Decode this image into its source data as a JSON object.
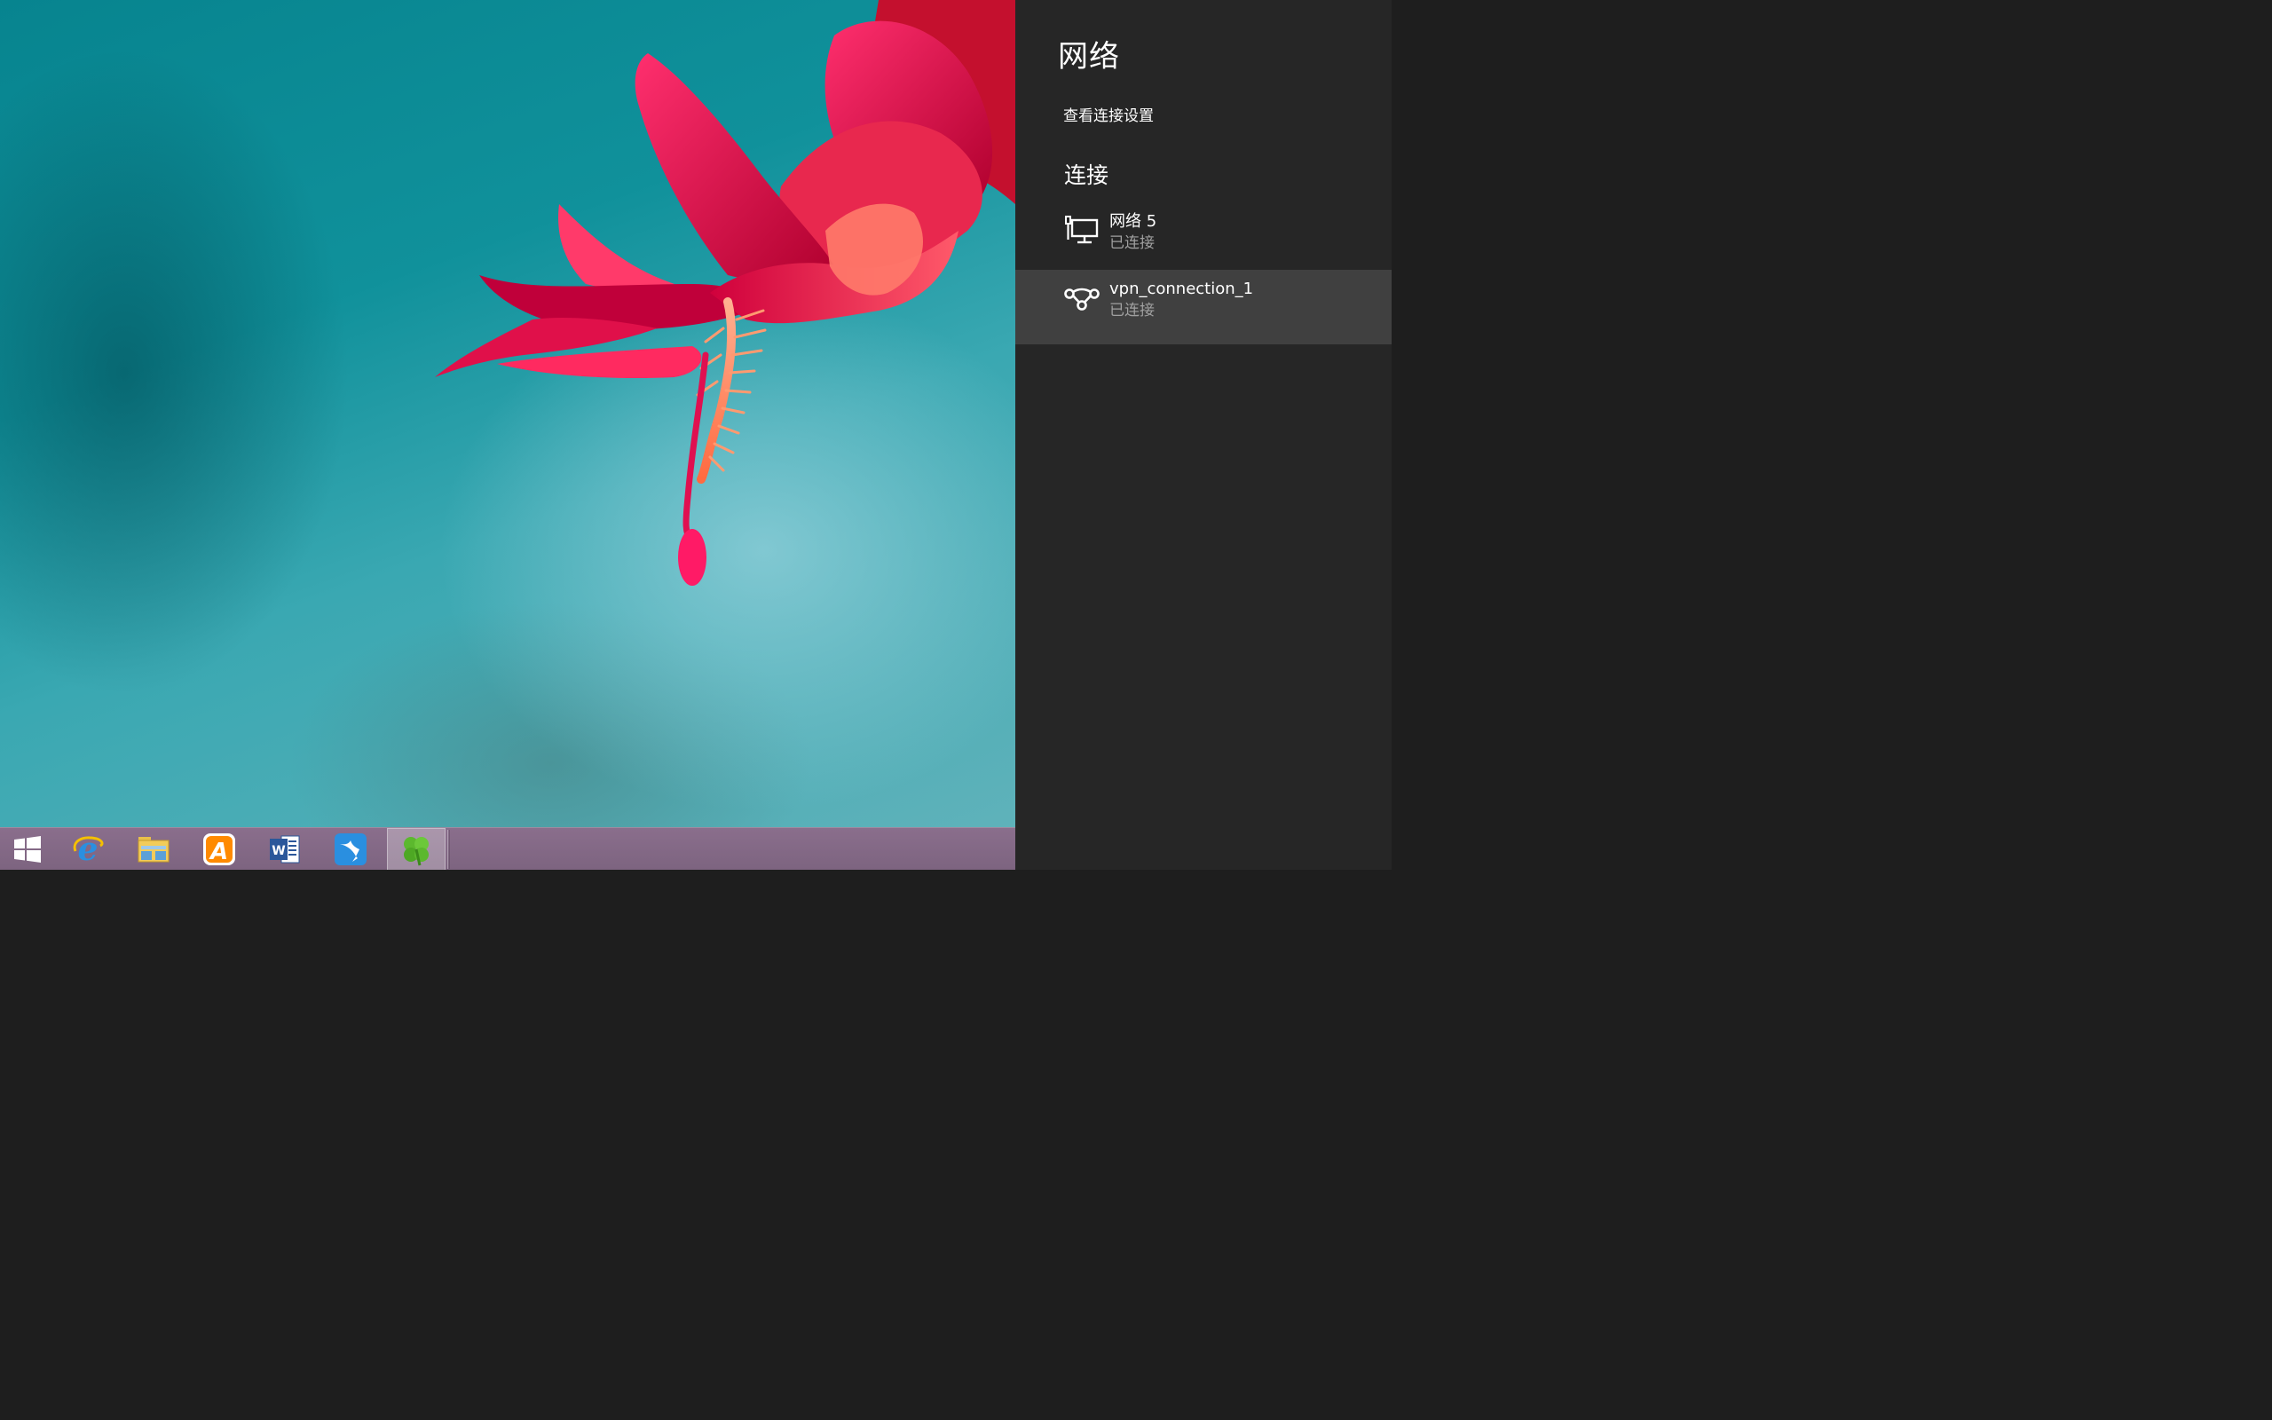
{
  "panel": {
    "title": "网络",
    "view_settings_label": "查看连接设置",
    "section_title": "连接",
    "connections": [
      {
        "name": "网络  5",
        "status": "已连接",
        "icon": "ethernet-icon",
        "selected": false
      },
      {
        "name": "vpn_connection_1",
        "status": "已连接",
        "icon": "vpn-icon",
        "selected": true
      }
    ]
  },
  "taskbar": {
    "items": [
      {
        "name": "start-icon",
        "active": false
      },
      {
        "name": "internet-explorer-icon",
        "active": false
      },
      {
        "name": "file-explorer-icon",
        "active": false
      },
      {
        "name": "app-store-a-icon",
        "active": false
      },
      {
        "name": "word-icon",
        "active": false
      },
      {
        "name": "bird-app-icon",
        "active": false
      },
      {
        "name": "clover-app-icon",
        "active": true
      }
    ]
  },
  "colors": {
    "panel_bg": "#262626",
    "selected_row_bg": "#404040",
    "status_text": "#a0a0a0",
    "taskbar_bg": "#7d6480"
  }
}
